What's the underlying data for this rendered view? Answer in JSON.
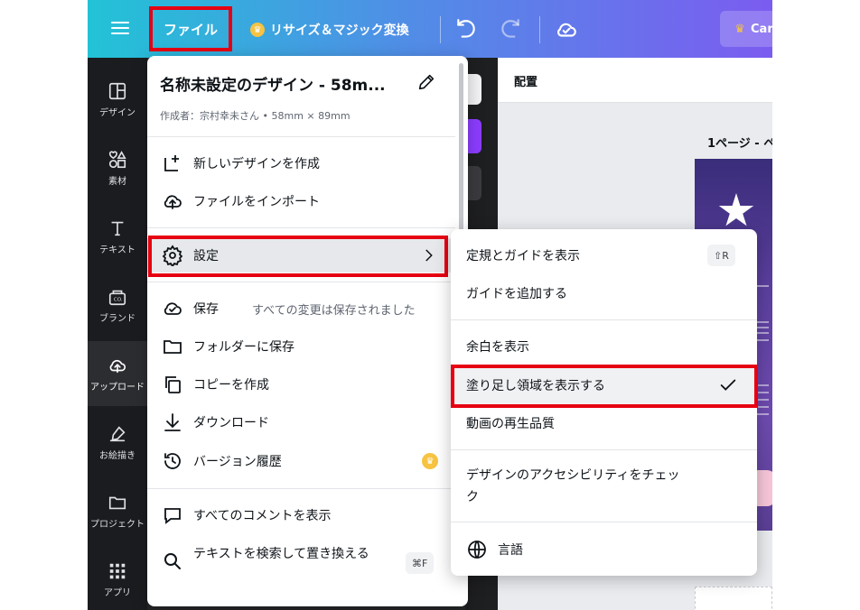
{
  "topbar": {
    "file_label": "ファイル",
    "resize_label": "リサイズ＆マジック変換",
    "canva_button": "Car"
  },
  "sidebar": {
    "items": [
      {
        "label": "デザイン",
        "icon": "layout-icon"
      },
      {
        "label": "素材",
        "icon": "elements-icon"
      },
      {
        "label": "テキスト",
        "icon": "text-icon"
      },
      {
        "label": "ブランド",
        "icon": "brand-icon"
      },
      {
        "label": "アップロード",
        "icon": "upload-icon"
      },
      {
        "label": "お絵描き",
        "icon": "draw-icon"
      },
      {
        "label": "プロジェクト",
        "icon": "folder-icon"
      },
      {
        "label": "アプリ",
        "icon": "apps-icon"
      }
    ]
  },
  "canvas": {
    "header": "配置",
    "page_label": "1ページ - ペ"
  },
  "file_menu": {
    "title": "名称未設定のデザイン - 58m...",
    "subtitle": "作成者：宗村幸未さん • 58mm × 89mm",
    "items": {
      "new_design": "新しいデザインを作成",
      "import": "ファイルをインポート",
      "settings": "設定",
      "save": "保存",
      "save_note": "すべての変更は保存されました",
      "save_to_folder": "フォルダーに保存",
      "make_copy": "コピーを作成",
      "download": "ダウンロード",
      "version_history": "バージョン履歴",
      "show_comments": "すべてのコメントを表示",
      "find_replace": "テキストを検索して置き換える",
      "find_replace_shortcut": "⌘F"
    }
  },
  "settings_menu": {
    "items": {
      "rulers_guides": "定規とガイドを表示",
      "rulers_shortcut": "⇧R",
      "add_guides": "ガイドを追加する",
      "show_margins": "余白を表示",
      "show_bleed": "塗り足し領域を表示する",
      "video_quality": "動画の再生品質",
      "accessibility": "デザインのアクセシビリティをチェック",
      "language": "言語"
    }
  },
  "colors": {
    "highlight_border": "#e60012",
    "sidebar_bg": "#1b1c1f",
    "accent_purple": "#8b3dff"
  }
}
